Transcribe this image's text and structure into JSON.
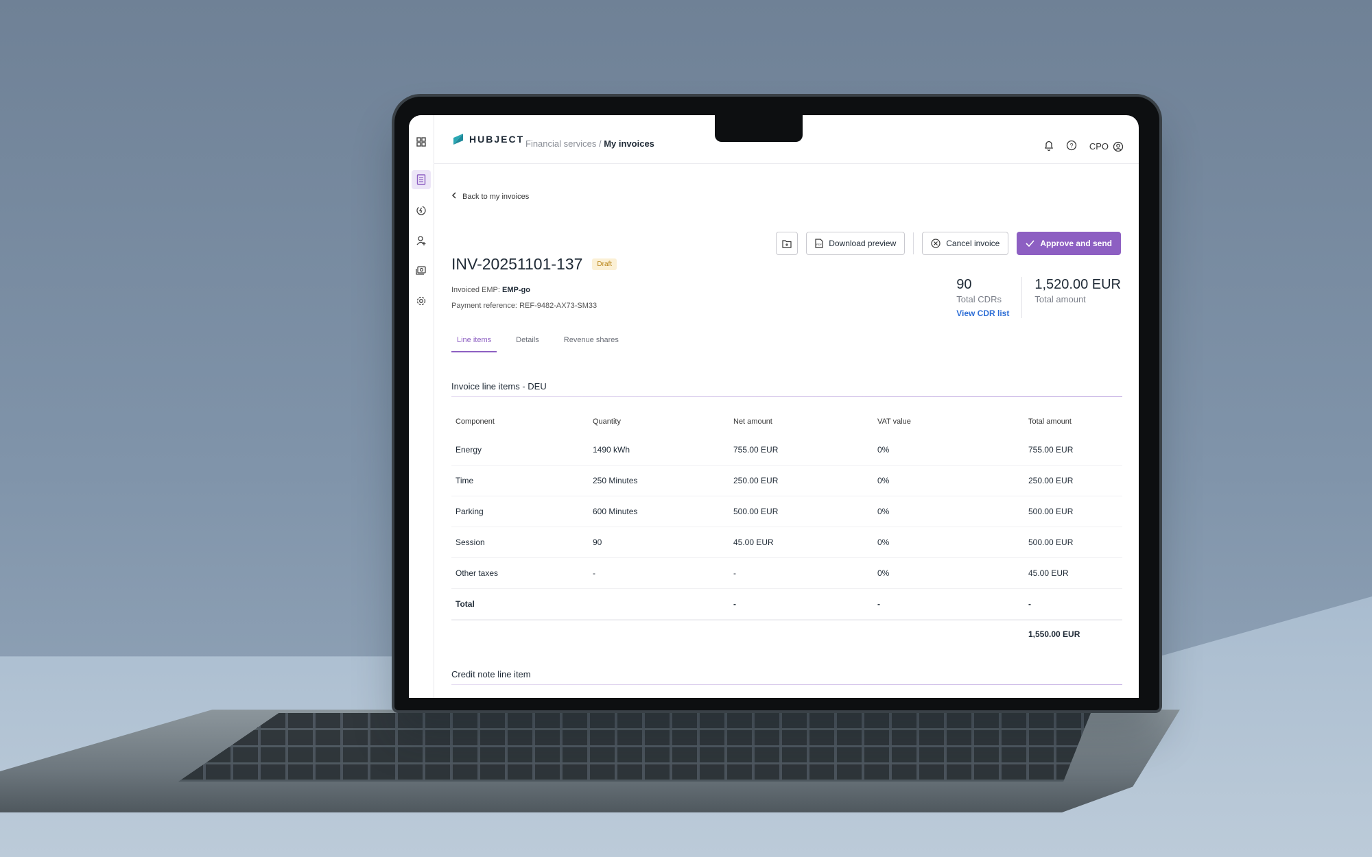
{
  "theme": {
    "accent": "#8d5fc2",
    "link": "#2f6fd6",
    "badge_bg": "#fbf0d5",
    "brand": "#1f8a9a"
  },
  "header": {
    "brand": "HUBJECT",
    "breadcrumb_parent": "Financial services",
    "breadcrumb_separator": "/",
    "breadcrumb_current": "My invoices",
    "role": "CPO"
  },
  "sidebar": {
    "items": [
      {
        "icon": "invoice-icon",
        "active": true
      },
      {
        "icon": "energy-icon",
        "active": false
      },
      {
        "icon": "user-add-icon",
        "active": false
      },
      {
        "icon": "money-icon",
        "active": false
      },
      {
        "icon": "gear-icon",
        "active": false
      }
    ]
  },
  "back_label": "Back to my invoices",
  "actions": {
    "download_preview": "Download preview",
    "cancel_invoice": "Cancel invoice",
    "approve_send": "Approve and send"
  },
  "invoice": {
    "number": "INV-20251101-137",
    "status": "Draft",
    "emp_label": "Invoiced EMP:",
    "emp_value": "EMP-go",
    "payment_ref_label": "Payment reference:",
    "payment_ref_value": "REF-9482-AX73-SM33"
  },
  "stats": {
    "cdrs_value": "90",
    "cdrs_label": "Total CDRs",
    "cdrs_link": "View CDR list",
    "total_value": "1,520.00 EUR",
    "total_label": "Total amount"
  },
  "tabs": [
    "Line items",
    "Details",
    "Revenue shares"
  ],
  "section_title": "Invoice line items - DEU",
  "table": {
    "headers": [
      "Component",
      "Quantity",
      "Net amount",
      "VAT value",
      "Total amount"
    ],
    "rows": [
      [
        "Energy",
        "1490 kWh",
        "755.00 EUR",
        "0%",
        "755.00 EUR"
      ],
      [
        "Time",
        "250 Minutes",
        "250.00 EUR",
        "0%",
        "250.00 EUR"
      ],
      [
        "Parking",
        "600 Minutes",
        "500.00 EUR",
        "0%",
        "500.00 EUR"
      ],
      [
        "Session",
        "90",
        "45.00 EUR",
        "0%",
        "500.00 EUR"
      ],
      [
        "Other taxes",
        "-",
        "-",
        "0%",
        "45.00 EUR"
      ]
    ],
    "total_row": [
      "Total",
      "",
      "-",
      "-",
      "-"
    ],
    "grand_total": "1,550.00 EUR"
  },
  "credit_section_title": "Credit note line item"
}
